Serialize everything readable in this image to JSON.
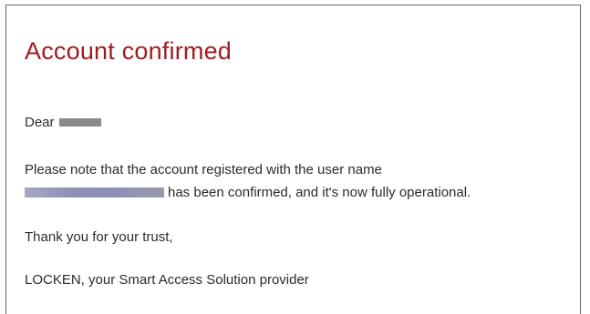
{
  "email": {
    "title": "Account confirmed",
    "greeting": "Dear",
    "notice_line1": "Please note that the account registered with the user name",
    "notice_line2": "has been confirmed, and it's now fully operational.",
    "thanks": "Thank you for your trust,",
    "signature": "LOCKEN, your Smart Access Solution provider"
  },
  "colors": {
    "heading": "#a01c22",
    "body_text": "#2b2b2b",
    "redaction": "#8a8a8a",
    "frame_border": "#6b6b6b"
  }
}
